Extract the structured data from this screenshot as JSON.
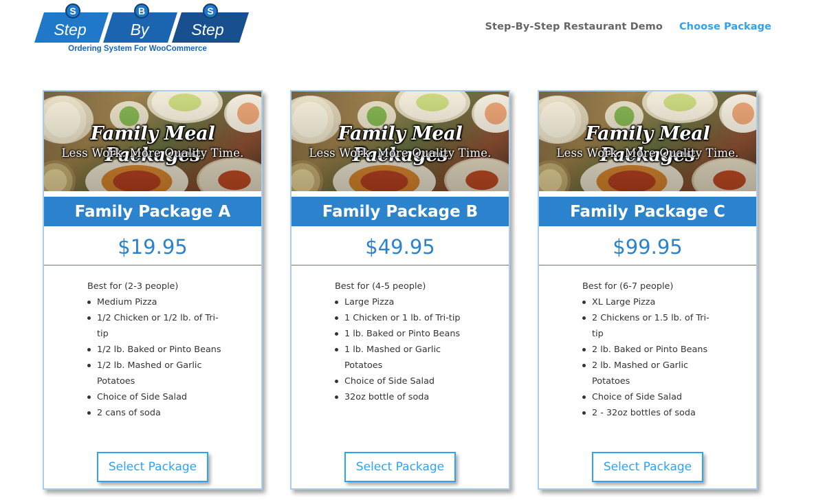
{
  "logo": {
    "words": [
      "Step",
      "By",
      "Step"
    ],
    "badges": [
      "S",
      "B",
      "S"
    ],
    "tagline": "Ordering System For WooCommerce"
  },
  "nav": {
    "items": [
      {
        "label": "Step-By-Step Restaurant Demo",
        "active": false
      },
      {
        "label": "Choose Package",
        "active": true
      }
    ]
  },
  "colors": {
    "brand_blue": "#2b83ce",
    "link_blue": "#2ea3f2",
    "card_border": "#a9cdea"
  },
  "banner": {
    "title": "Family Meal Packages",
    "subtitle": "Less Work. More Quality Time."
  },
  "packages": [
    {
      "name": "Family Package A",
      "price": "$19.95",
      "best_for": "Best for (2-3 people)",
      "items": [
        "Medium Pizza",
        "1/2 Chicken or 1/2 lb. of Tri-tip",
        "1/2 lb. Baked or Pinto Beans",
        "1/2 lb. Mashed or Garlic Potatoes",
        "Choice of Side Salad",
        "2 cans of soda"
      ],
      "button": "Select Package"
    },
    {
      "name": "Family Package B",
      "price": "$49.95",
      "best_for": "Best for (4-5 people)",
      "items": [
        "Large Pizza",
        "1 Chicken or 1 lb. of Tri-tip",
        "1 lb. Baked or Pinto Beans",
        "1 lb. Mashed or Garlic Potatoes",
        "Choice of Side Salad",
        "32oz bottle of soda"
      ],
      "button": "Select Package"
    },
    {
      "name": "Family Package C",
      "price": "$99.95",
      "best_for": "Best for (6-7 people)",
      "items": [
        "XL Large Pizza",
        "2 Chickens or 1.5 lb. of Tri-tip",
        "2 lb. Baked or Pinto Beans",
        "2 lb. Mashed or Garlic Potatoes",
        "Choice of Side Salad",
        "2 - 32oz bottles of soda"
      ],
      "button": "Select Package"
    }
  ]
}
